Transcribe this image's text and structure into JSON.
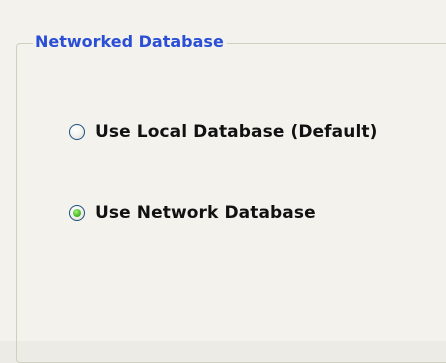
{
  "groupbox": {
    "title": "Networked Database"
  },
  "options": [
    {
      "label": "Use Local Database (Default)",
      "selected": false
    },
    {
      "label": "Use Network Database",
      "selected": true
    }
  ],
  "colors": {
    "title": "#2a4fd6",
    "background": "#f3f2ec",
    "border": "#d0d0bf",
    "radio_border": "#1d5180",
    "radio_selected_dot": "#4fbf2a"
  }
}
